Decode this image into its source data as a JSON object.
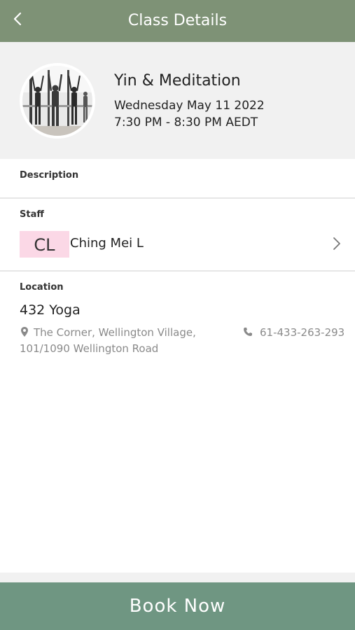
{
  "header": {
    "title": "Class Details",
    "back_icon": "chevron-left-icon"
  },
  "class": {
    "name": "Yin & Meditation",
    "date": "Wednesday May 11 2022",
    "time": "7:30 PM - 8:30 PM AEDT"
  },
  "description": {
    "label": "Description"
  },
  "staff": {
    "label": "Staff",
    "initials": "CL",
    "name": "Ching Mei L"
  },
  "location": {
    "label": "Location",
    "name": "432 Yoga",
    "address_line1": "The Corner, Wellington Village,",
    "address_line2": "101/1090 Wellington Road",
    "phone": "61-433-263-293"
  },
  "actions": {
    "book_label": "Book Now"
  },
  "colors": {
    "header_bg": "#7e9276",
    "book_button_bg": "#6f9682",
    "initials_bg": "#fbd8e6",
    "card_bg": "#f1f1f1"
  }
}
